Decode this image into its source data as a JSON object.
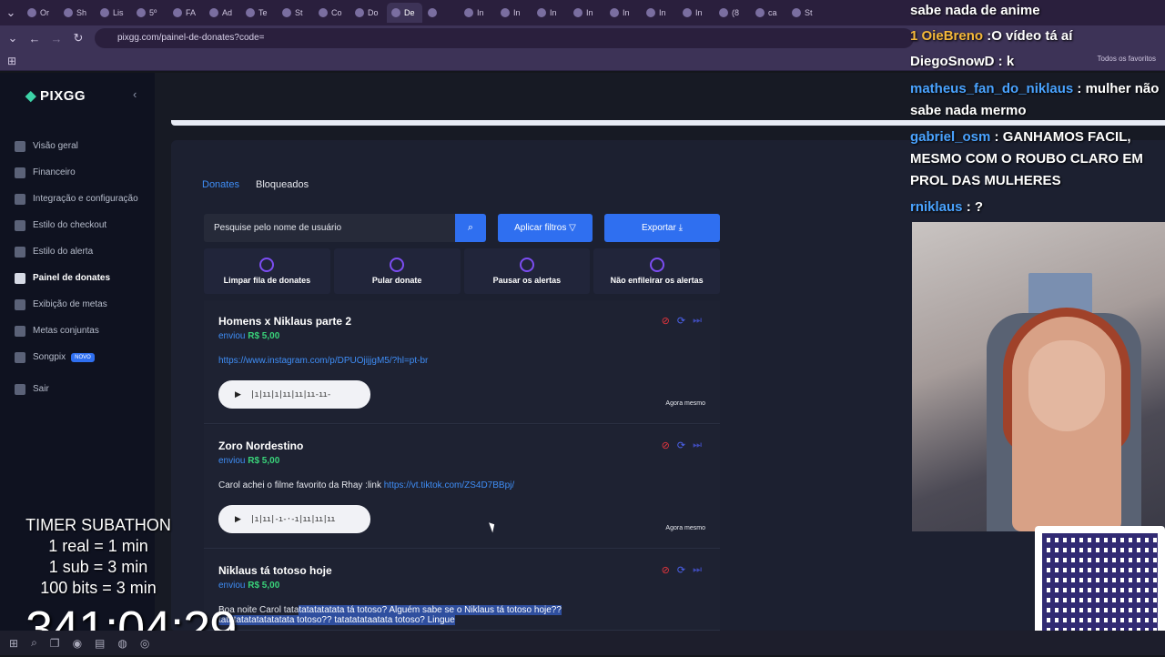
{
  "browser": {
    "tabs": [
      {
        "label": "Or"
      },
      {
        "label": "Sh"
      },
      {
        "label": "Lis"
      },
      {
        "label": "5º"
      },
      {
        "label": "FA"
      },
      {
        "label": "Ad"
      },
      {
        "label": "Te"
      },
      {
        "label": "St"
      },
      {
        "label": "Co"
      },
      {
        "label": "Do"
      },
      {
        "label": "De",
        "active": true
      },
      {
        "label": ""
      },
      {
        "label": "In"
      },
      {
        "label": "In"
      },
      {
        "label": "In"
      },
      {
        "label": "In"
      },
      {
        "label": "In"
      },
      {
        "label": "In"
      },
      {
        "label": "In"
      },
      {
        "label": "(8"
      },
      {
        "label": "ca"
      },
      {
        "label": "St"
      }
    ],
    "url": "pixgg.com/painel-de-donates?code=",
    "bookmarks_right": "Todos os favoritos"
  },
  "sidebar": {
    "logo": "PIXGG",
    "items": [
      {
        "label": "Visão geral",
        "icon": "home-icon"
      },
      {
        "label": "Financeiro",
        "icon": "wallet-icon"
      },
      {
        "label": "Integração e configuração",
        "icon": "settings-icon"
      },
      {
        "label": "Estilo do checkout",
        "icon": "palette-icon"
      },
      {
        "label": "Estilo do alerta",
        "icon": "palette-icon"
      },
      {
        "label": "Painel de donates",
        "icon": "chart-icon",
        "active": true
      },
      {
        "label": "Exibição de metas",
        "icon": "star-icon"
      },
      {
        "label": "Metas conjuntas",
        "icon": "group-icon"
      },
      {
        "label": "Songpix",
        "icon": "music-icon",
        "badge": "NOVO"
      },
      {
        "label": "Sair",
        "icon": "logout-icon"
      }
    ]
  },
  "panel": {
    "tabs": [
      {
        "label": "Donates",
        "active": true
      },
      {
        "label": "Bloqueados"
      }
    ],
    "search_placeholder": "Pesquise pelo nome de usuário",
    "apply_filters": "Aplicar filtros",
    "export": "Exportar",
    "actions": [
      {
        "label": "Limpar fila de donates",
        "icon": "eraser-icon"
      },
      {
        "label": "Pular donate",
        "icon": "skip-icon"
      },
      {
        "label": "Pausar os alertas",
        "icon": "pause-icon"
      },
      {
        "label": "Não enfileirar os alertas",
        "icon": "bell-off-icon"
      }
    ],
    "donations": [
      {
        "title": "Homens x Niklaus parte 2",
        "sent_prefix": "enviou",
        "amount": "R$ 5,00",
        "message": "",
        "link": "https://www.instagram.com/p/DPUOjijjgM5/?hl=pt-br",
        "audio_wave": "|ı|ıı|ı|ıı|ıı|ıı-ıı-",
        "time": "Agora mesmo"
      },
      {
        "title": "Zoro Nordestino",
        "sent_prefix": "enviou",
        "amount": "R$ 5,00",
        "message": "Carol achei o filme favorito da Rhay :link ",
        "link": "https://vt.tiktok.com/ZS4D7BBpj/",
        "audio_wave": "|ı|ıı|-ı-·-ı|ıı|ıı|ıı",
        "time": "Agora mesmo"
      },
      {
        "title": "Niklaus tá totoso hoje",
        "sent_prefix": "enviou",
        "amount": "R$ 5,00",
        "message": "Boa noite Carol tata",
        "selected": "tatatatatata tá totoso? Alguém sabe se o Niklaus tá totoso hoje??",
        "message2": "tatatatatatatatatata totoso?? tatatatataatata totoso? Lingue"
      }
    ]
  },
  "overlay": {
    "chat": [
      {
        "user": "",
        "text": "sabe nada de anime"
      },
      {
        "user": "OieBreno",
        "text": ":O vídeo tá aí",
        "badge": "1"
      },
      {
        "user": "DiegoSnowD",
        "text": ": k"
      },
      {
        "user": "matheus_fan_do_niklaus",
        "text": ": mulher não sabe nada mermo"
      },
      {
        "user": "gabriel_osm",
        "text": ": GANHAMOS FACIL, MESMO COM O ROUBO CLARO EM PROL DAS MULHERES"
      },
      {
        "user": "rniklaus",
        "text": ": ?"
      }
    ],
    "timer_lines": [
      "TIMER SUBATHON",
      "1 real = 1 min",
      "1 sub = 3 min",
      "100 bits = 3 min"
    ],
    "clock": "341:04:29"
  }
}
